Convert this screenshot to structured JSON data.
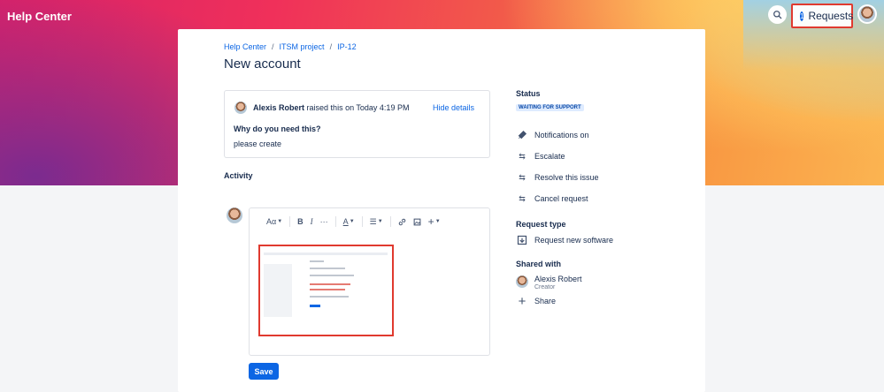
{
  "app": {
    "brand": "Help Center"
  },
  "top_nav": {
    "requests_label": "Requests",
    "requests_count": "1"
  },
  "breadcrumb": [
    "Help Center",
    "ITSM project",
    "IP-12"
  ],
  "page_title": "New account",
  "details": {
    "author": "Alexis Robert",
    "raised_text": "raised this on Today 4:19 PM",
    "hide_label": "Hide details",
    "question": "Why do you need this?",
    "answer": "please create"
  },
  "activity": {
    "label": "Activity",
    "toolbar": {
      "text_style": "Aα"
    },
    "save_label": "Save"
  },
  "sidebar": {
    "status_heading": "Status",
    "status_value": "WAITING FOR SUPPORT",
    "actions": [
      "Notifications on",
      "Escalate",
      "Resolve this issue",
      "Cancel request"
    ],
    "request_type_heading": "Request type",
    "request_type": "Request new software",
    "shared_heading": "Shared with",
    "shared_name": "Alexis Robert",
    "shared_role": "Creator",
    "share_label": "Share"
  },
  "colors": {
    "primary": "#0c66e4",
    "highlight": "#e03a2f",
    "lozenge_bg": "#deebff"
  }
}
